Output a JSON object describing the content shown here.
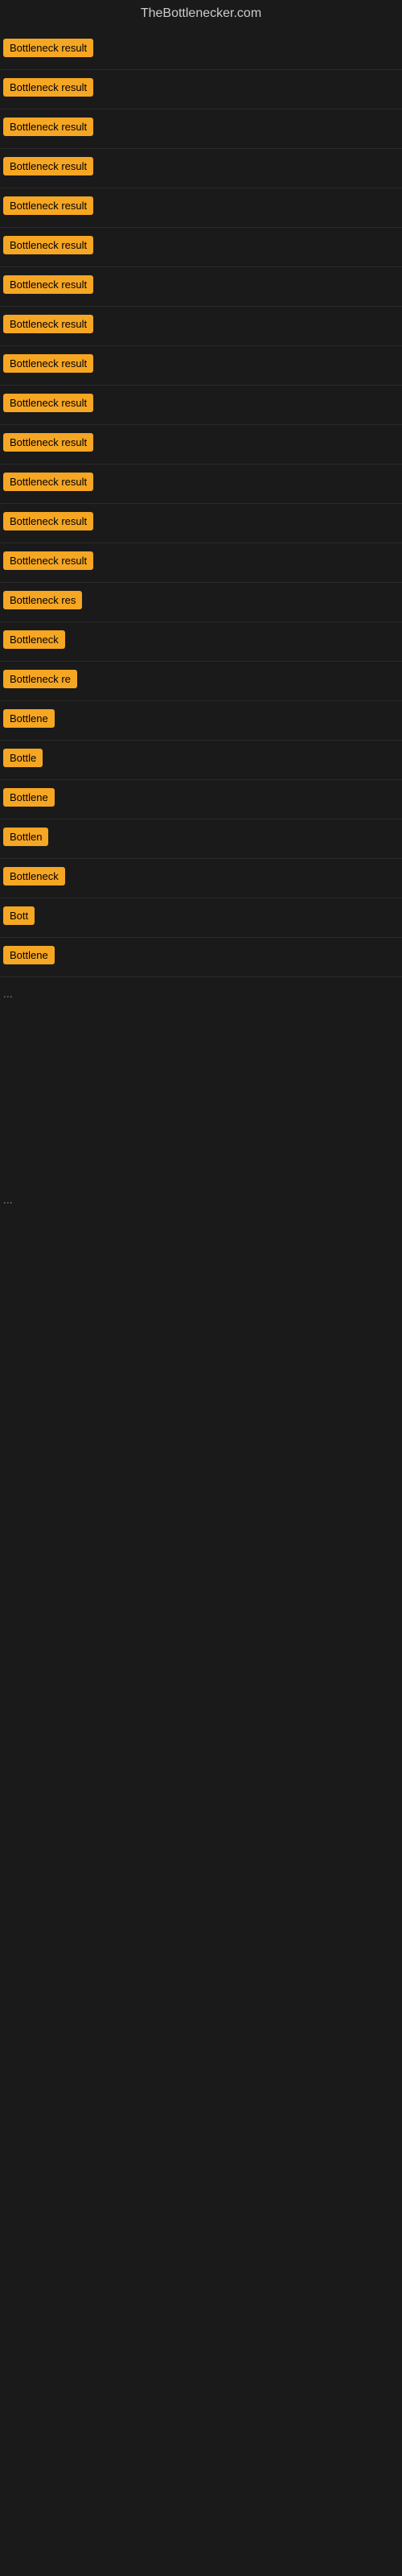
{
  "site": {
    "title": "TheBottlenecker.com"
  },
  "results": [
    {
      "label": "Bottleneck result",
      "width": 135
    },
    {
      "label": "Bottleneck result",
      "width": 135
    },
    {
      "label": "Bottleneck result",
      "width": 135
    },
    {
      "label": "Bottleneck result",
      "width": 135
    },
    {
      "label": "Bottleneck result",
      "width": 135
    },
    {
      "label": "Bottleneck result",
      "width": 135
    },
    {
      "label": "Bottleneck result",
      "width": 135
    },
    {
      "label": "Bottleneck result",
      "width": 135
    },
    {
      "label": "Bottleneck result",
      "width": 135
    },
    {
      "label": "Bottleneck result",
      "width": 135
    },
    {
      "label": "Bottleneck result",
      "width": 135
    },
    {
      "label": "Bottleneck result",
      "width": 135
    },
    {
      "label": "Bottleneck result",
      "width": 135
    },
    {
      "label": "Bottleneck result",
      "width": 135
    },
    {
      "label": "Bottleneck res",
      "width": 115
    },
    {
      "label": "Bottleneck",
      "width": 82
    },
    {
      "label": "Bottleneck re",
      "width": 100
    },
    {
      "label": "Bottlene",
      "width": 72
    },
    {
      "label": "Bottle",
      "width": 52
    },
    {
      "label": "Bottlene",
      "width": 72
    },
    {
      "label": "Bottlen",
      "width": 62
    },
    {
      "label": "Bottleneck",
      "width": 82
    },
    {
      "label": "Bott",
      "width": 40
    },
    {
      "label": "Bottlene",
      "width": 72
    }
  ],
  "ellipsis": "...",
  "accent_color": "#f5a623"
}
